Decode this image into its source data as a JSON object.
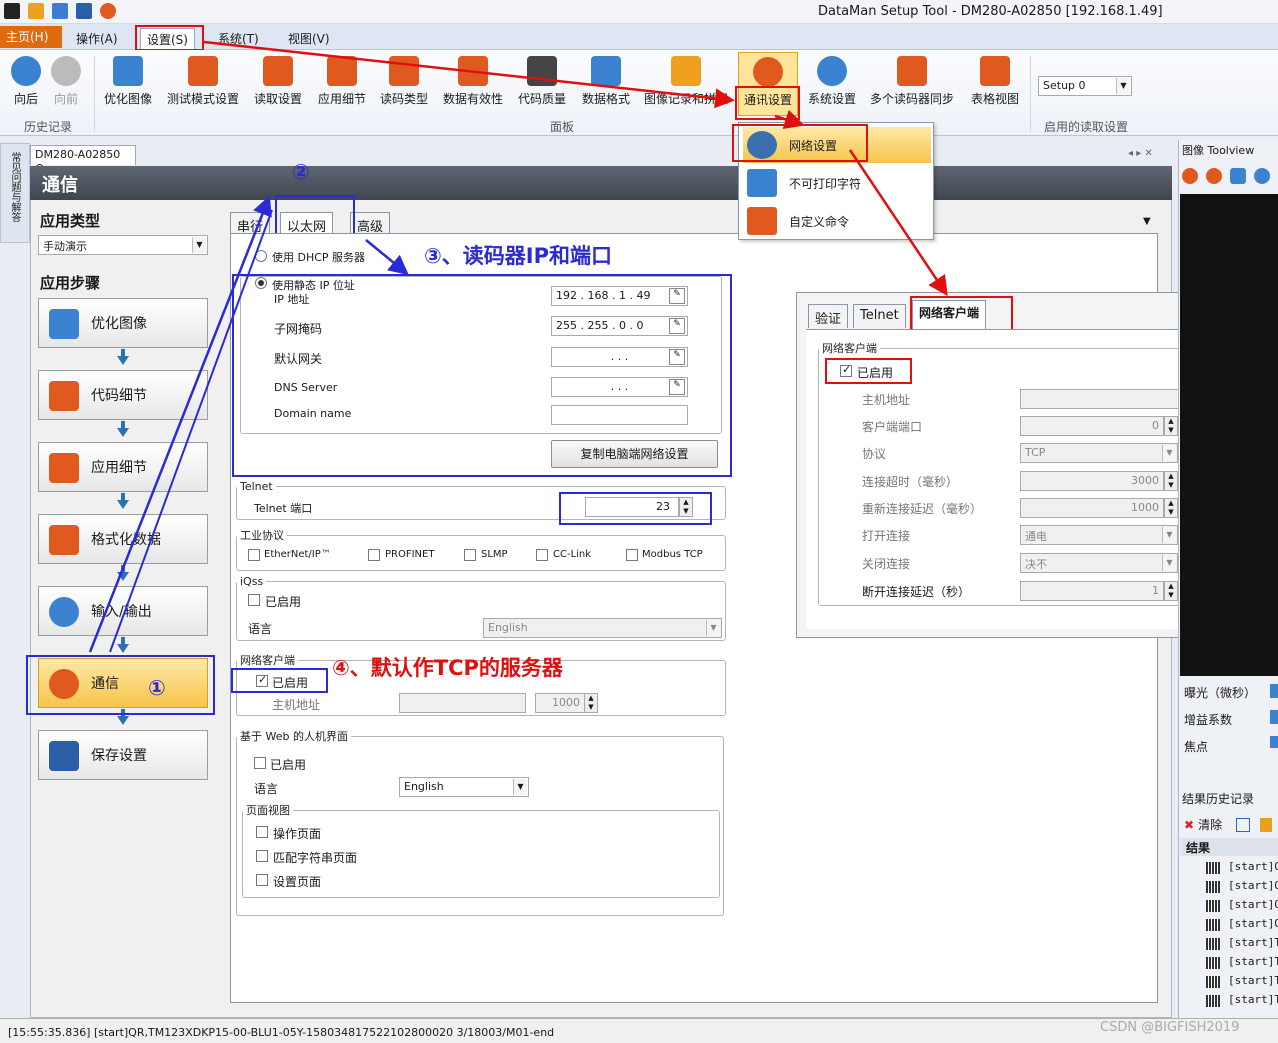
{
  "window": {
    "title": "DataMan Setup Tool - DM280-A02850 [192.168.1.49]"
  },
  "menu": {
    "home": "主页(H)",
    "operation": "操作(A)",
    "settings": "设置(S)",
    "system": "系统(T)",
    "view": "视图(V)"
  },
  "ribbon": {
    "back": "向后",
    "forward": "向前",
    "history_group": "历史记录",
    "buttons": [
      "优化图像",
      "测试模式设置",
      "读取设置",
      "应用细节",
      "读码类型",
      "数据有效性",
      "代码质量",
      "数据格式",
      "图像记录和拼缀",
      "通讯设置",
      "系统设置",
      "多个读码器同步",
      "表格视图"
    ],
    "panel_group": "面板",
    "setup_combo": "Setup 0",
    "setup_group": "启用的读取设置"
  },
  "dropdown": {
    "items": [
      "网络设置",
      "不可打印字符",
      "自定义命令"
    ]
  },
  "doc_tab": "DM280-A02850",
  "side_tab": "常见问题与解答",
  "page_header": "通信",
  "app_type": {
    "label": "应用类型",
    "value": "手动演示"
  },
  "app_steps": {
    "label": "应用步骤",
    "items": [
      "优化图像",
      "代码细节",
      "应用细节",
      "格式化数据",
      "输入/输出",
      "通信",
      "保存设置"
    ]
  },
  "tabs": [
    "串行",
    "以太网",
    "高级"
  ],
  "ethernet": {
    "dhcp": "使用 DHCP 服务器",
    "static": "使用静态 IP 位址",
    "ip_label": "IP 地址",
    "ip_value": "192 . 168 . 1 . 49",
    "subnet_label": "子网掩码",
    "subnet_value": "255 . 255 . 0 . 0",
    "gateway_label": "默认网关",
    "gateway_value": ". . .",
    "dns_label": "DNS Server",
    "dns_value": ". . .",
    "domain_label": "Domain name",
    "copy_button": "复制电脑端网络设置"
  },
  "telnet": {
    "legend": "Telnet",
    "port_label": "Telnet 端口",
    "port_value": "23"
  },
  "industrial": {
    "legend": "工业协议",
    "items": [
      "EtherNet/IP™",
      "PROFINET",
      "SLMP",
      "CC-Link",
      "Modbus TCP"
    ]
  },
  "iqss": {
    "legend": "iQss",
    "enabled": "已启用",
    "lang_label": "语言",
    "lang_value": "English"
  },
  "netclient": {
    "legend": "网络客户端",
    "enabled": "已启用",
    "host_label": "主机地址",
    "port_value": "1000"
  },
  "web": {
    "legend": "基于 Web 的人机界面",
    "enabled": "已启用",
    "lang_label": "语言",
    "lang_value": "English",
    "pageview_legend": "页面视图",
    "pages": [
      "操作页面",
      "匹配字符串页面",
      "设置页面"
    ]
  },
  "popup": {
    "tabs": [
      "验证",
      "Telnet",
      "网络客户端"
    ],
    "legend": "网络客户端",
    "enabled": "已启用",
    "rows": [
      {
        "label": "主机地址",
        "value": ""
      },
      {
        "label": "客户端端口",
        "value": "0"
      },
      {
        "label": "协议",
        "value": "TCP"
      },
      {
        "label": "连接超时（毫秒）",
        "value": "3000"
      },
      {
        "label": "重新连接延迟（毫秒）",
        "value": "1000"
      },
      {
        "label": "打开连接",
        "value": "通电"
      },
      {
        "label": "关闭连接",
        "value": "决不"
      },
      {
        "label": "断开连接延迟（秒）",
        "value": "1"
      }
    ],
    "host_port": "1000"
  },
  "annotations": {
    "a1": "①",
    "a2": "②",
    "a3": "③、读码器IP和端口",
    "a4": "④、默认作TCP的服务器"
  },
  "right_panel": {
    "title": "图像 Toolview",
    "exposure": "曝光（微秒）",
    "gain": "增益系数",
    "focus": "焦点",
    "history_title": "结果历史记录",
    "clear": "清除",
    "results_header": "结果",
    "results": [
      "[start]Q",
      "[start]Q",
      "[start]Q",
      "[start]Q",
      "[start]T",
      "[start]T",
      "[start]T",
      "[start]T"
    ]
  },
  "status": "[15:55:35.836] [start]QR,TM123XDKP15-00-BLU1-05Y-158034817522102800020 3/18003/M01-end",
  "watermark": "CSDN @BIGFISH2019"
}
